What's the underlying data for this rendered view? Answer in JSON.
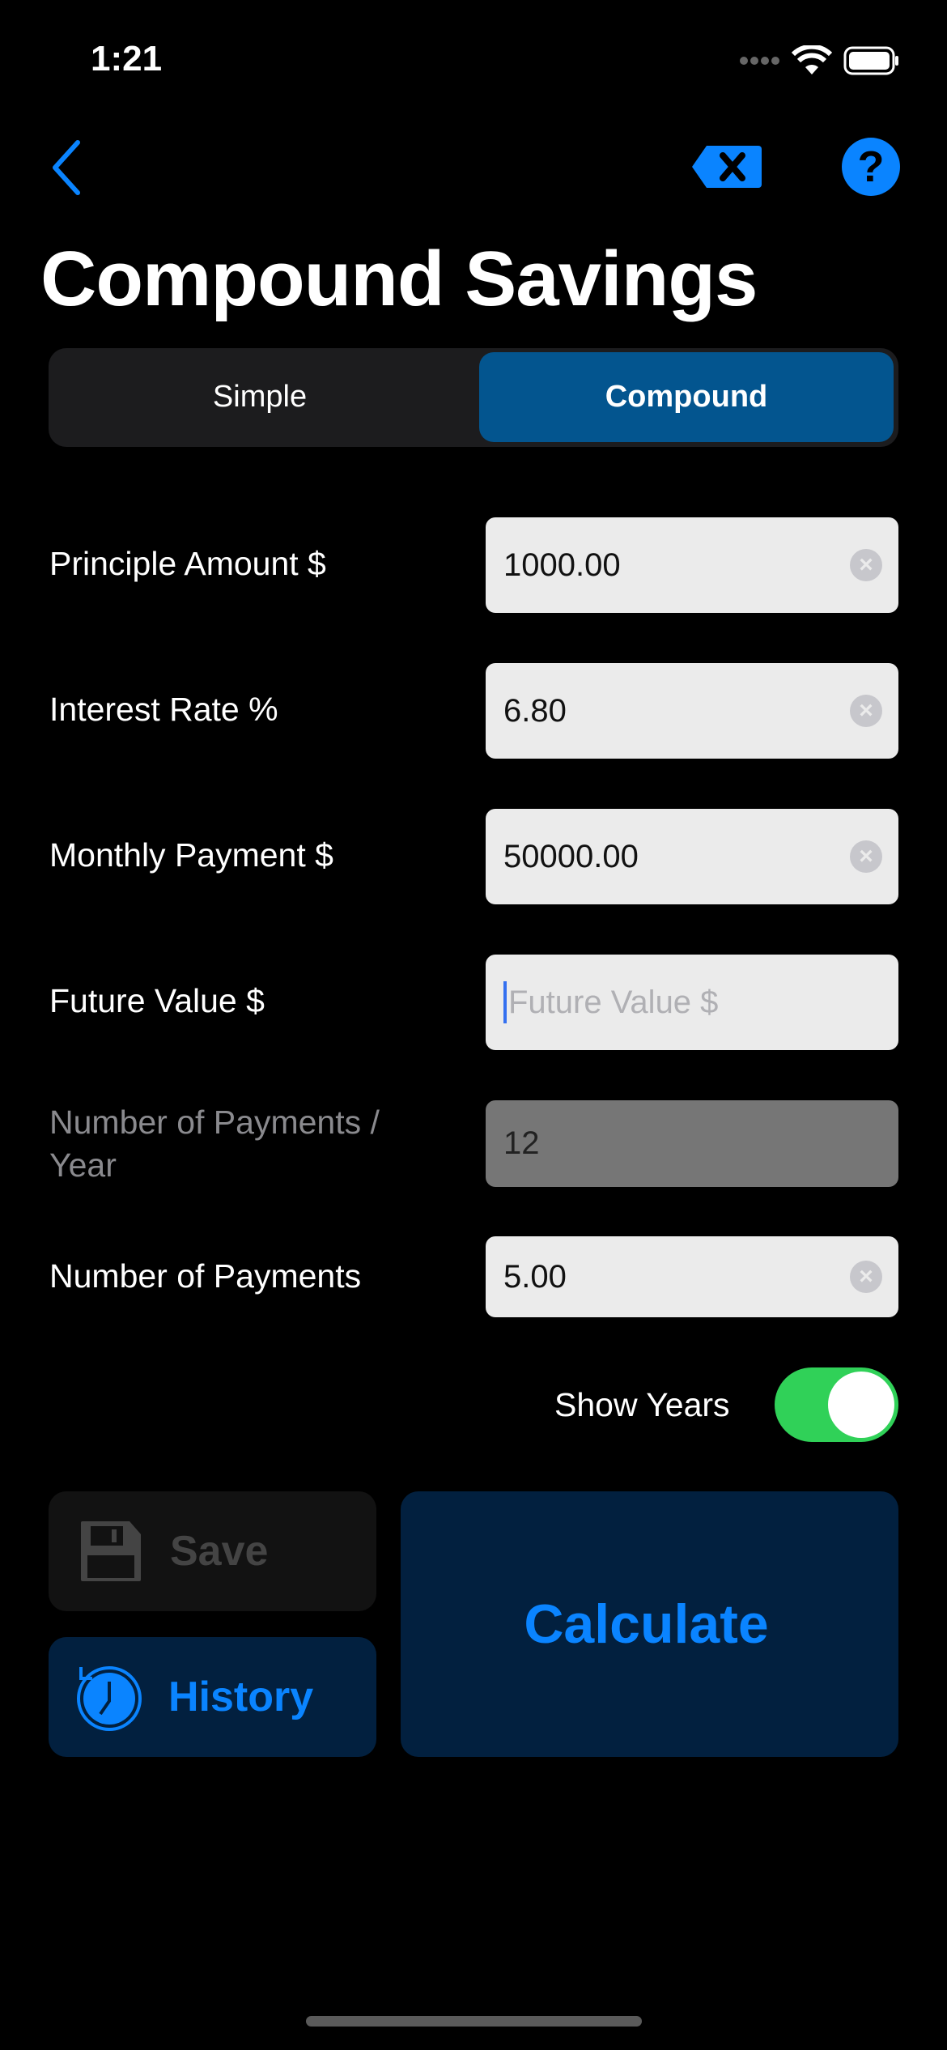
{
  "status_bar": {
    "time": "1:21"
  },
  "nav": {
    "back_icon": "chevron-left-icon",
    "delete_icon": "delete-left-icon",
    "help_icon": "question-circle-icon"
  },
  "title": "Compound Savings",
  "segmented": {
    "options": [
      "Simple",
      "Compound"
    ],
    "selected": "Compound"
  },
  "fields": [
    {
      "label": "Principle Amount $",
      "value": "1000.00",
      "placeholder": "Principle Amount $"
    },
    {
      "label": "Interest Rate %",
      "value": "6.80",
      "placeholder": "Interest Rate %"
    },
    {
      "label": "Monthly Payment $",
      "value": "50000.00",
      "placeholder": "Monthly Payment $"
    },
    {
      "label": "Future Value $",
      "value": "",
      "placeholder": "Future Value $"
    },
    {
      "label": "Number of Payments / Year",
      "value": "12",
      "disabled": true
    },
    {
      "label": "Number of Payments",
      "value": "5.00",
      "placeholder": "Number of Payments"
    }
  ],
  "toggle": {
    "label": "Show Years",
    "on": true,
    "color": "#30d158"
  },
  "buttons": {
    "save": "Save",
    "history": "History",
    "calculate": "Calculate"
  },
  "colors": {
    "accent": "#0a84ff",
    "segment_selected": "#03558f",
    "button_bg": "#02203f"
  }
}
